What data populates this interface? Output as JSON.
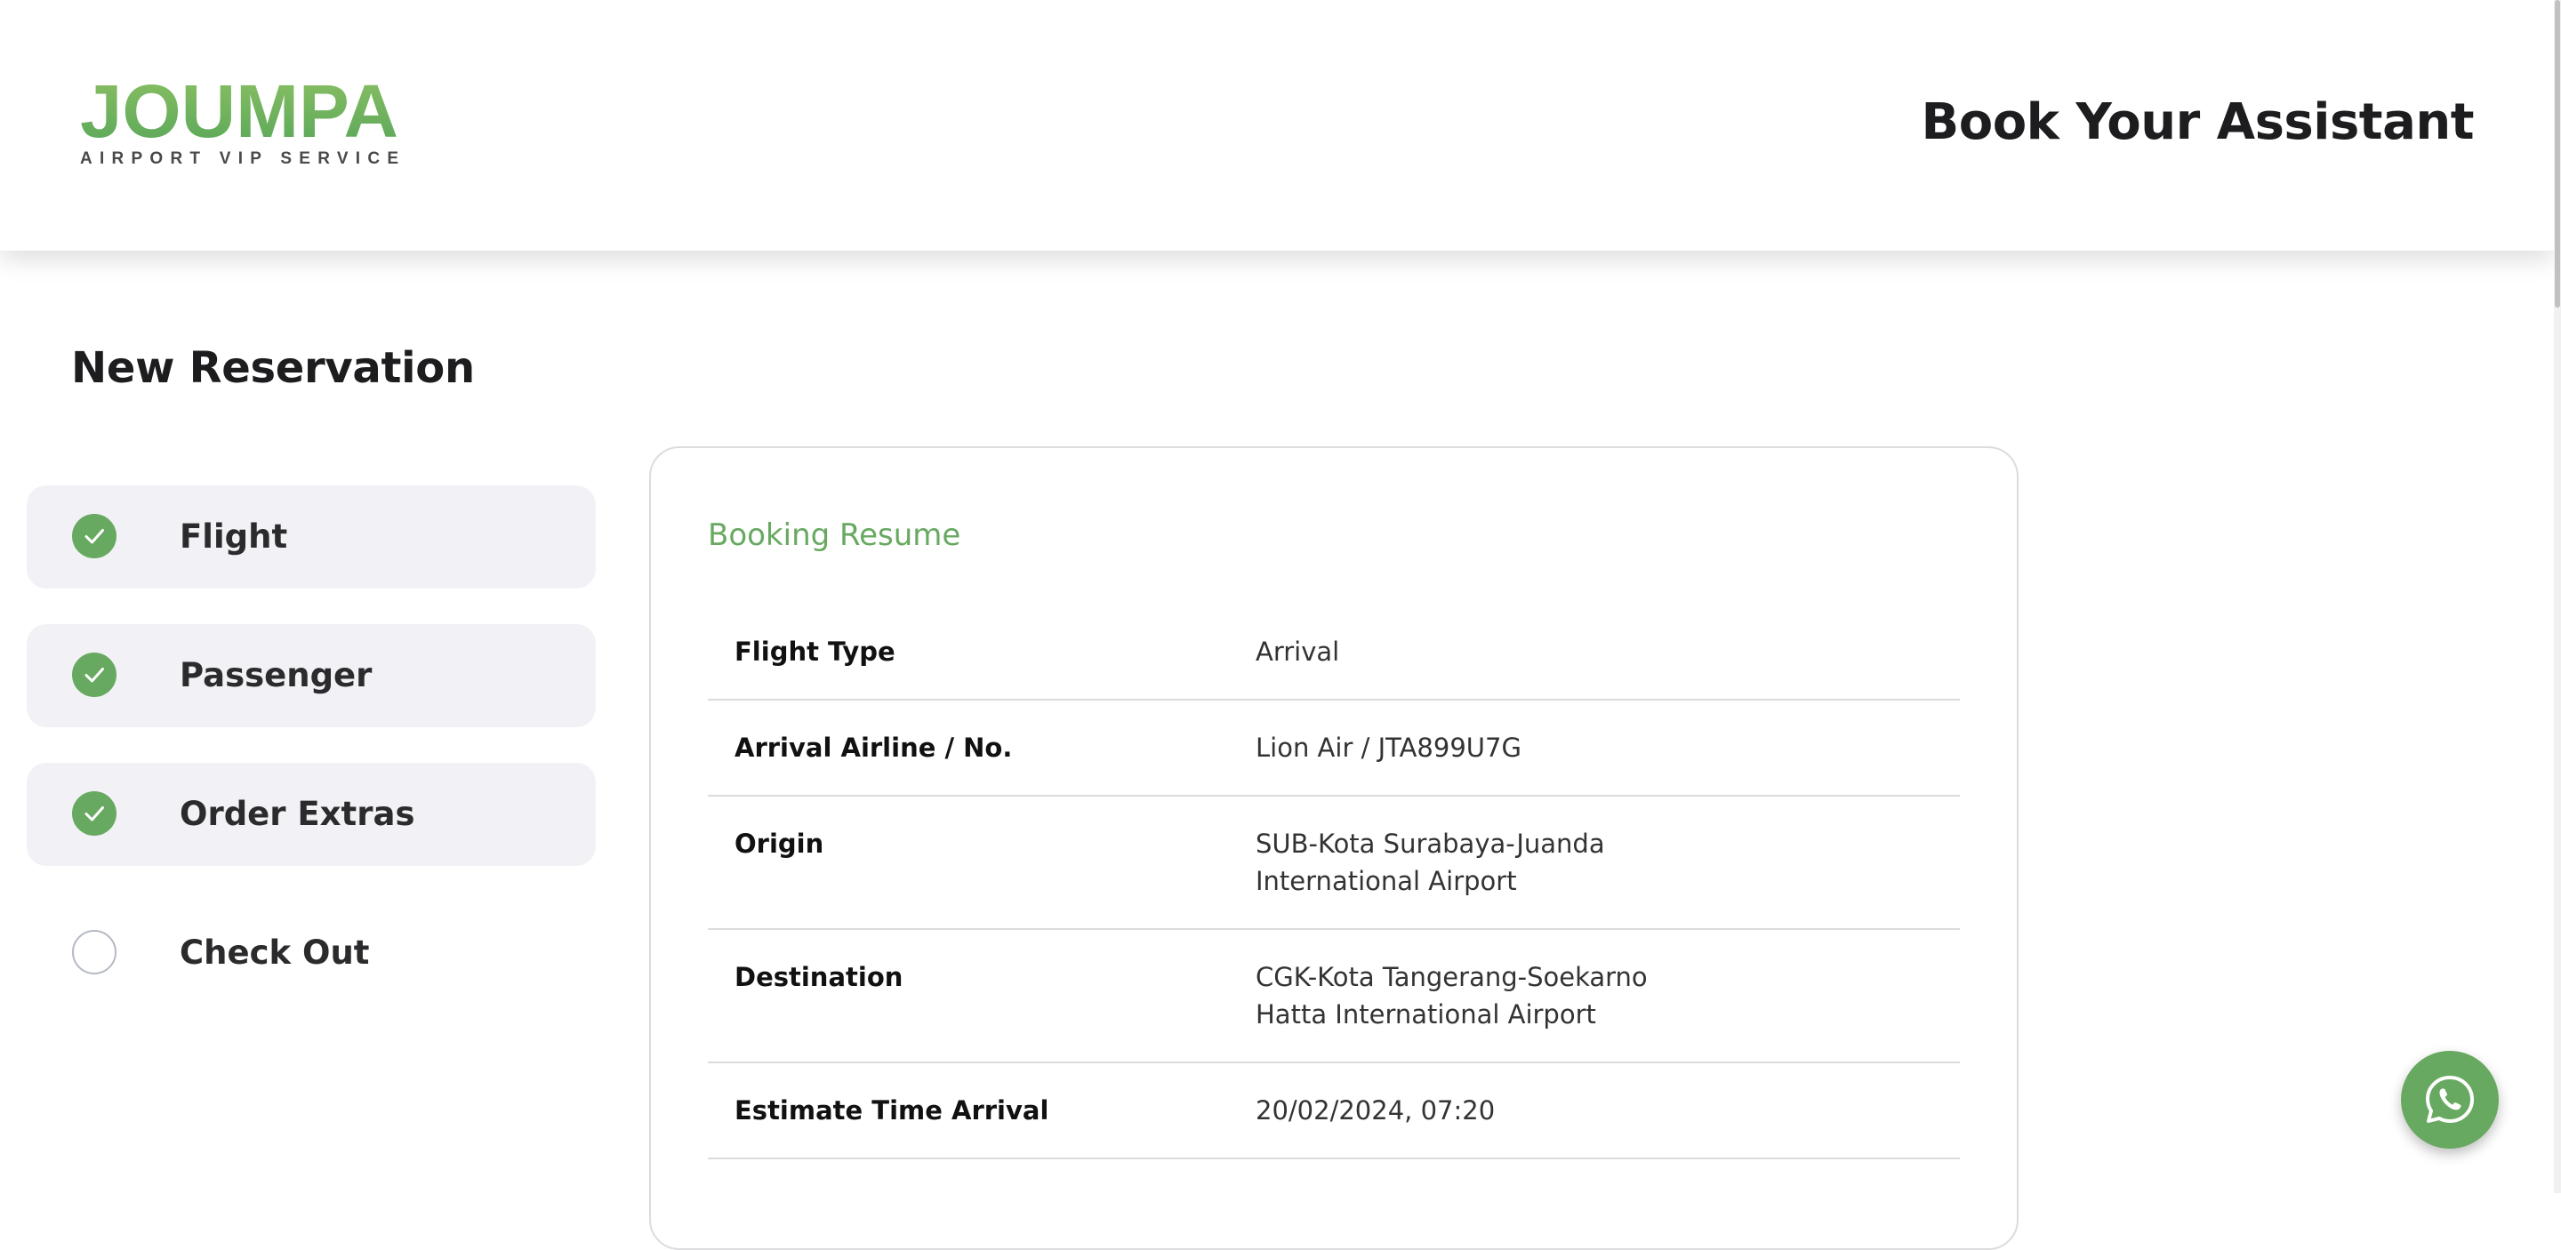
{
  "brand": {
    "logo_word": "JOUMPA",
    "logo_tagline": "AIRPORT VIP SERVICE",
    "accent_color": "#68a961"
  },
  "header": {
    "title": "Book Your Assistant"
  },
  "page": {
    "title": "New Reservation"
  },
  "steps": [
    {
      "label": "Flight",
      "status": "completed",
      "icon": "check-icon"
    },
    {
      "label": "Passenger",
      "status": "completed",
      "icon": "check-icon"
    },
    {
      "label": "Order Extras",
      "status": "completed",
      "icon": "check-icon"
    },
    {
      "label": "Check Out",
      "status": "pending",
      "icon": "empty-circle-icon"
    }
  ],
  "booking_resume": {
    "title": "Booking Resume",
    "rows": [
      {
        "key": "Flight Type",
        "value": "Arrival"
      },
      {
        "key": "Arrival Airline / No.",
        "value": "Lion Air / JTA899U7G"
      },
      {
        "key": "Origin",
        "value": "SUB-Kota Surabaya-Juanda International Airport"
      },
      {
        "key": "Destination",
        "value": "CGK-Kota Tangerang-Soekarno Hatta International Airport"
      },
      {
        "key": "Estimate Time Arrival",
        "value": "20/02/2024, 07:20"
      }
    ]
  },
  "floating": {
    "icon": "whatsapp-icon"
  }
}
